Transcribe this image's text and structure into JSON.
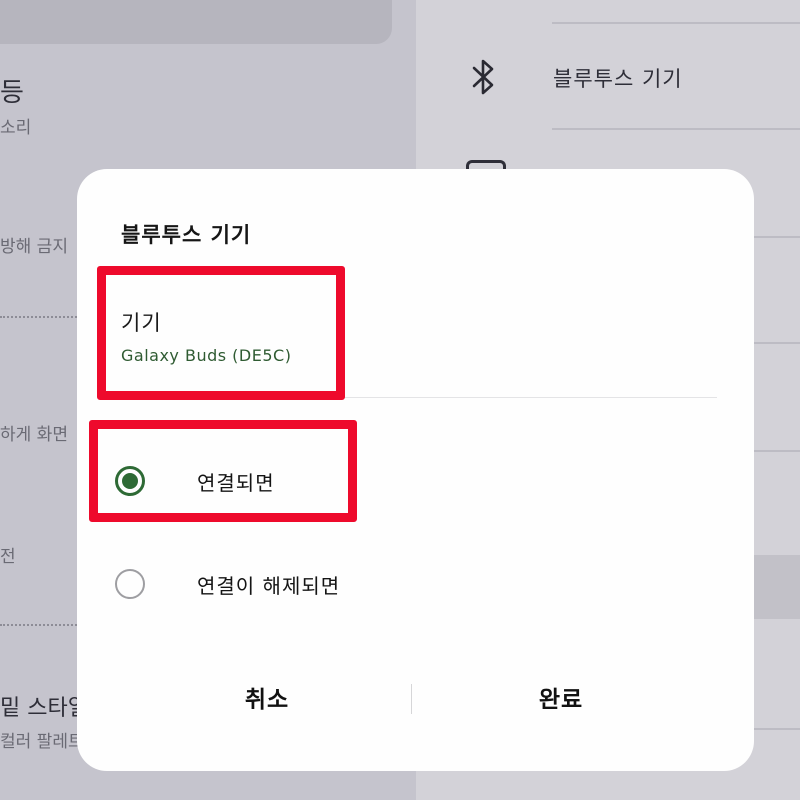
{
  "background": {
    "left_texts": [
      "등",
      "소리",
      "방해 금지",
      "하게 화면",
      "전",
      "밑 스타일",
      "컬러 팔레트"
    ],
    "right_items": [
      {
        "label": "블루투스 기기",
        "icon": "bluetooth-icon"
      }
    ]
  },
  "dialog": {
    "title": "블루투스 기기",
    "device": {
      "label": "기기",
      "value": "Galaxy Buds (DE5C)"
    },
    "options": [
      {
        "label": "연결되면",
        "selected": true
      },
      {
        "label": "연결이 해제되면",
        "selected": false
      }
    ],
    "buttons": {
      "cancel": "취소",
      "done": "완료"
    }
  },
  "colors": {
    "accent": "#2e6a35",
    "highlight": "#ee0a2c",
    "dim_overlay": "#c5c4cd"
  }
}
